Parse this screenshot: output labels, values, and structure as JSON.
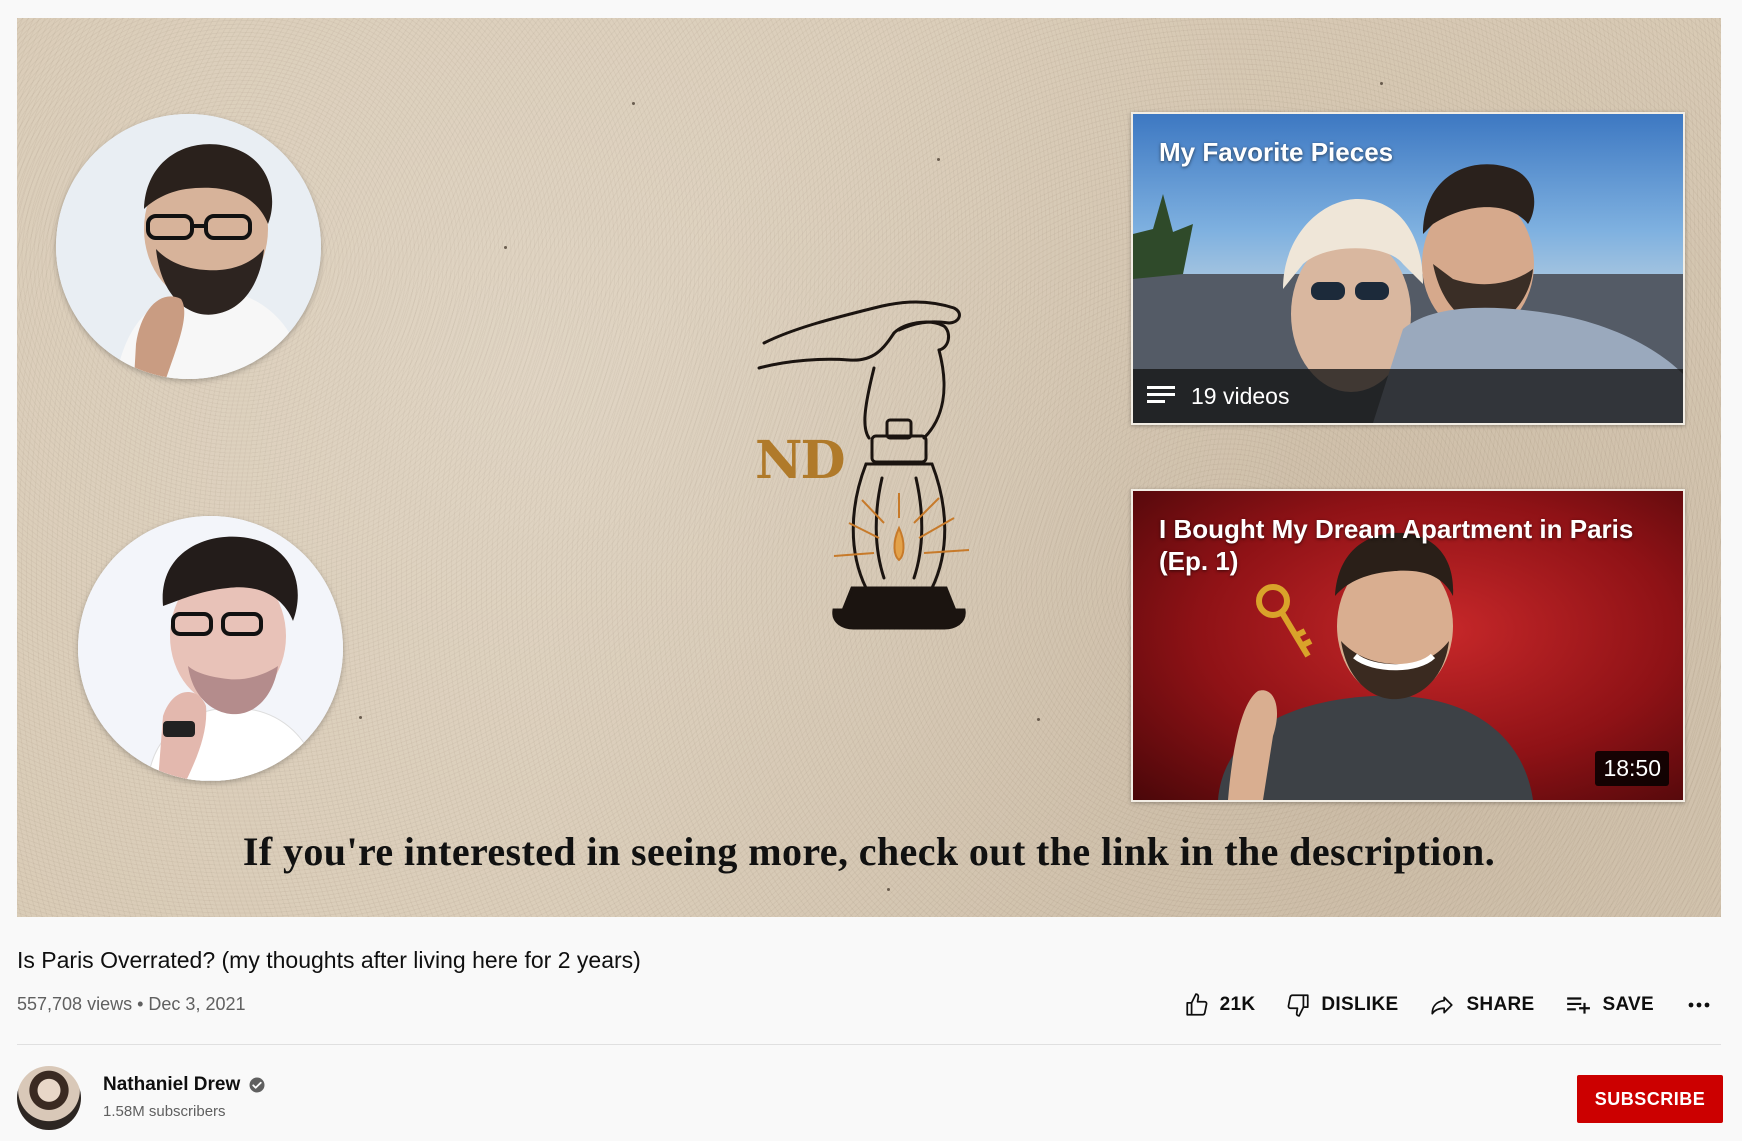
{
  "end_screen": {
    "playlist_card": {
      "title": "My Favorite Pieces",
      "video_count": "19 videos",
      "icon": "playlist-icon"
    },
    "video_card": {
      "title": "I Bought My Dream Apartment in Paris (Ep. 1)",
      "duration": "18:50"
    },
    "caption": "If you're interested in seeing more, check out the link in the description.",
    "logo_text": "ND"
  },
  "video": {
    "title": "Is Paris Overrated? (my thoughts after living here for 2 years)",
    "views": "557,708 views",
    "separator": "•",
    "date": "Dec 3, 2021"
  },
  "actions": {
    "like_count": "21K",
    "dislike_label": "DISLIKE",
    "share_label": "SHARE",
    "save_label": "SAVE"
  },
  "channel": {
    "name": "Nathaniel Drew",
    "subscribers": "1.58M subscribers",
    "verified": true
  },
  "subscribe_label": "SUBSCRIBE",
  "colors": {
    "subscribe_bg": "#cc0000",
    "paper_bg": "#d9cbb6",
    "page_bg": "#f9f9f9"
  }
}
